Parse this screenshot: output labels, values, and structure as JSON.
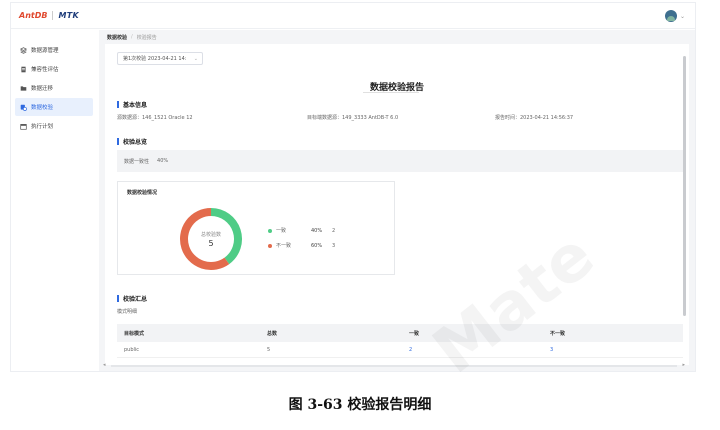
{
  "header": {
    "logo_brand": "AntDB",
    "logo_product": "MTK"
  },
  "sidebar": {
    "items": [
      {
        "label": "数据源管理",
        "icon": "layers-icon"
      },
      {
        "label": "兼容性评估",
        "icon": "document-icon"
      },
      {
        "label": "数据迁移",
        "icon": "folder-icon"
      },
      {
        "label": "数据校验",
        "icon": "database-check-icon",
        "active": true
      },
      {
        "label": "执行计划",
        "icon": "calendar-icon"
      }
    ]
  },
  "breadcrumb": {
    "parent": "数据校验",
    "separator": "/",
    "current": "校验报告"
  },
  "report": {
    "selector_value": "第1次校验 2023-04-21 14:",
    "title": "数据校验报告",
    "basic_info": {
      "heading": "基本信息",
      "source": "源数据源：146_1521 Oracle 12",
      "target": "目标端数据源：149_3333 AntDB-T 6.0",
      "report_time": "报告时间：2023-04-21 14:56:37"
    },
    "overview": {
      "heading": "校验总览",
      "consistency_label": "数据一致性",
      "consistency_value": "40%"
    },
    "chart_card": {
      "title": "数据校验情况",
      "center_label": "总校验数",
      "center_value": "5"
    },
    "chart_data": {
      "type": "pie",
      "categories": [
        "一致",
        "不一致"
      ],
      "values": [
        2,
        3
      ],
      "percentages": [
        "40%",
        "60%"
      ],
      "colors": [
        "#4fcc86",
        "#e36b4c"
      ],
      "center_label": "总校验数",
      "center_value": "5"
    },
    "summary": {
      "heading": "校验汇总",
      "mode_label": "模式明细",
      "columns": [
        "目标模式",
        "总数",
        "一致",
        "不一致"
      ],
      "rows": [
        [
          "public",
          "5",
          "2",
          "3"
        ]
      ]
    }
  },
  "caption": "图 3-63  校验报告明细",
  "watermark": "Mate"
}
